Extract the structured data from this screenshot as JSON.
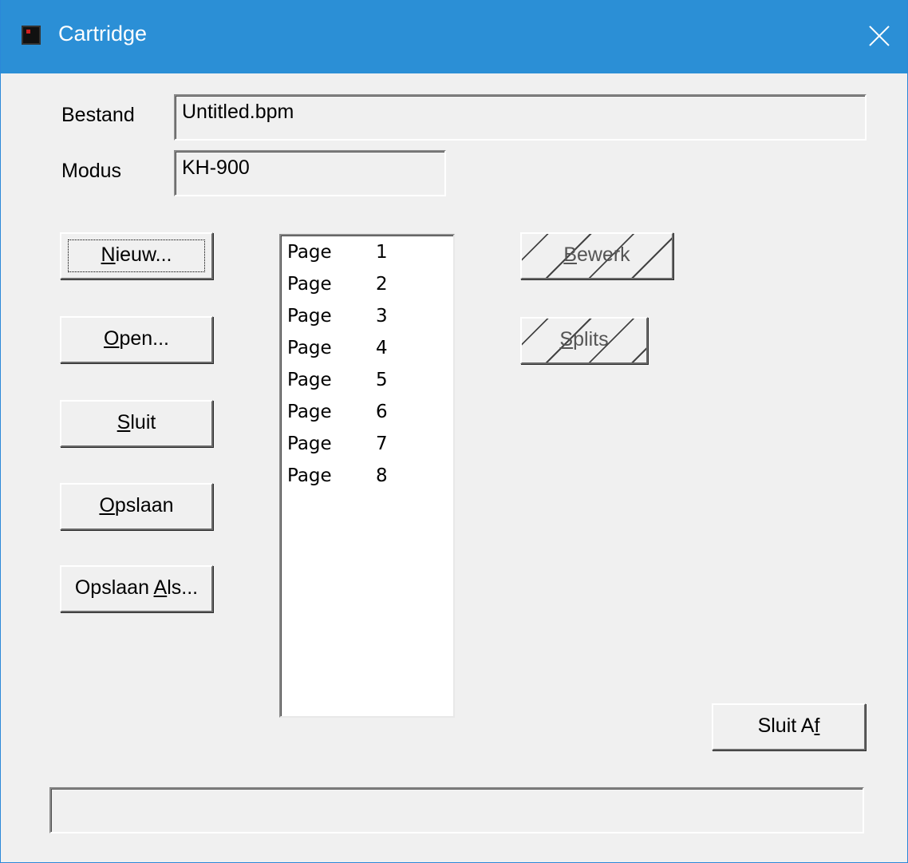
{
  "window": {
    "title": "Cartridge"
  },
  "fields": {
    "bestand_label": "Bestand",
    "bestand_value": "Untitled.bpm",
    "modus_label": "Modus",
    "modus_value": "KH-900"
  },
  "buttons": {
    "nieuw": {
      "mnemonic": "N",
      "rest": "ieuw..."
    },
    "open": {
      "mnemonic": "O",
      "rest": "pen..."
    },
    "sluit": {
      "mnemonic": "S",
      "rest": "luit"
    },
    "opslaan": {
      "mnemonic": "O",
      "rest": "pslaan"
    },
    "opslaan_als": {
      "pre": "Opslaan ",
      "mnemonic": "A",
      "rest": "ls..."
    },
    "bewerk": {
      "mnemonic": "B",
      "rest": "ewerk",
      "disabled": true
    },
    "splits": {
      "mnemonic": "S",
      "rest": "plits",
      "disabled": true
    },
    "sluit_af": {
      "pre": "Sluit A",
      "mnemonic": "f",
      "rest": ""
    }
  },
  "pages": [
    {
      "label": "Page",
      "number": "1"
    },
    {
      "label": "Page",
      "number": "2"
    },
    {
      "label": "Page",
      "number": "3"
    },
    {
      "label": "Page",
      "number": "4"
    },
    {
      "label": "Page",
      "number": "5"
    },
    {
      "label": "Page",
      "number": "6"
    },
    {
      "label": "Page",
      "number": "7"
    },
    {
      "label": "Page",
      "number": "8"
    }
  ],
  "statusbar": {
    "text": ""
  },
  "colors": {
    "titlebar": "#2b8fd6",
    "window_bg": "#f0f0f0"
  }
}
